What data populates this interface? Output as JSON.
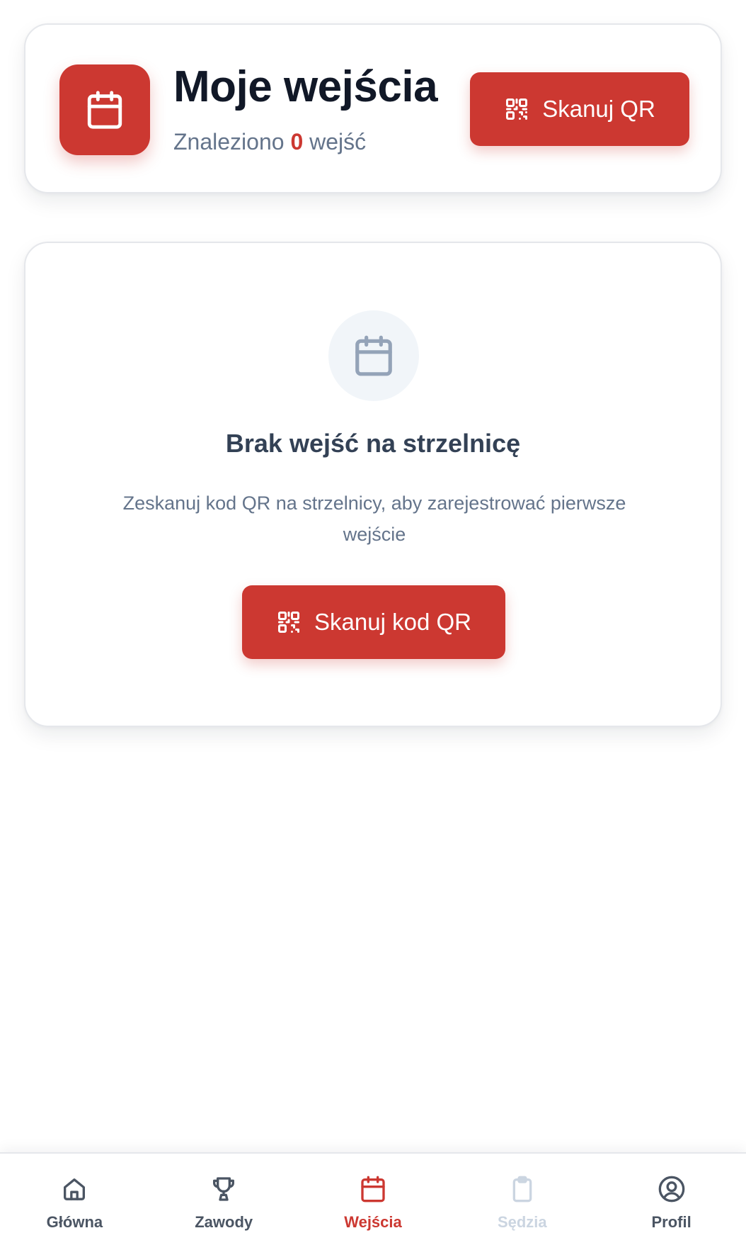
{
  "header": {
    "title": "Moje wejścia",
    "found_prefix": "Znaleziono",
    "count": "0",
    "found_suffix": "wejść",
    "scan_button": "Skanuj QR",
    "icon": "calendar-icon"
  },
  "empty_state": {
    "title": "Brak wejść na strzelnicę",
    "description": "Zeskanuj kod QR na strzelnicy, aby zarejestrować pierwsze wejście",
    "scan_button": "Skanuj kod QR",
    "icon": "calendar-icon"
  },
  "bottom_nav": {
    "items": [
      {
        "label": "Główna",
        "icon": "home-icon",
        "state": "normal"
      },
      {
        "label": "Zawody",
        "icon": "trophy-icon",
        "state": "normal"
      },
      {
        "label": "Wejścia",
        "icon": "calendar-icon",
        "state": "active"
      },
      {
        "label": "Sędzia",
        "icon": "clipboard-icon",
        "state": "disabled"
      },
      {
        "label": "Profil",
        "icon": "user-circle-icon",
        "state": "normal"
      }
    ]
  },
  "colors": {
    "accent": "#cc3831",
    "text_dark": "#111827",
    "text_muted": "#64748b",
    "disabled": "#cbd5e1"
  }
}
